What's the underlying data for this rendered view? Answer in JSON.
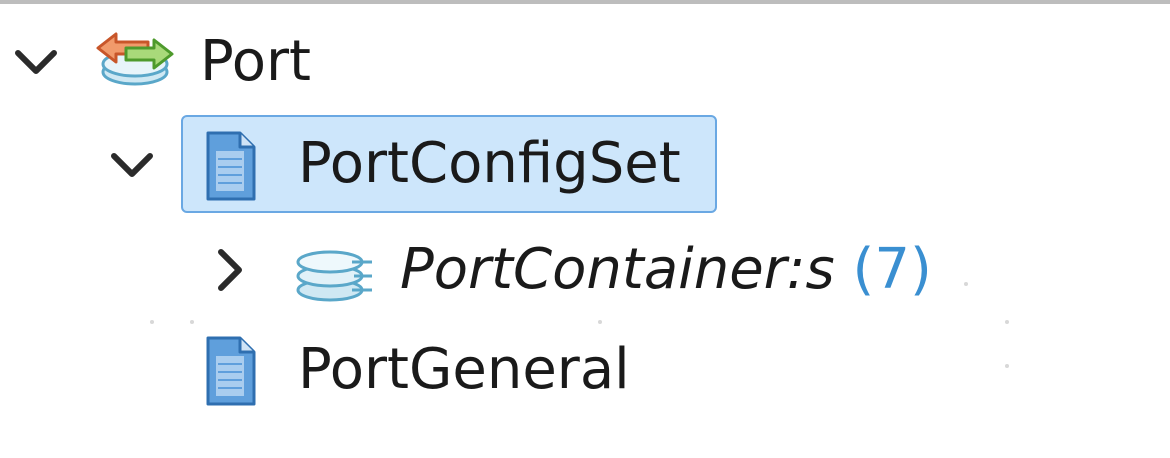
{
  "tree": {
    "items": [
      {
        "label": "Port",
        "icon": "port-arrows-icon",
        "expanded": true,
        "level": 0
      },
      {
        "label": "PortConfigSet",
        "icon": "document-icon",
        "expanded": true,
        "level": 1,
        "selected": true
      },
      {
        "label": "PortContainer:s",
        "count": "(7)",
        "icon": "stack-icon",
        "expanded": false,
        "level": 2,
        "italic": true
      },
      {
        "label": "PortGeneral",
        "icon": "document-icon",
        "level": 1
      }
    ]
  },
  "colors": {
    "selection_bg": "#cde6fb",
    "selection_border": "#6aa8e3",
    "count_text": "#3a8fd1",
    "top_rule": "#bdbdbd"
  }
}
